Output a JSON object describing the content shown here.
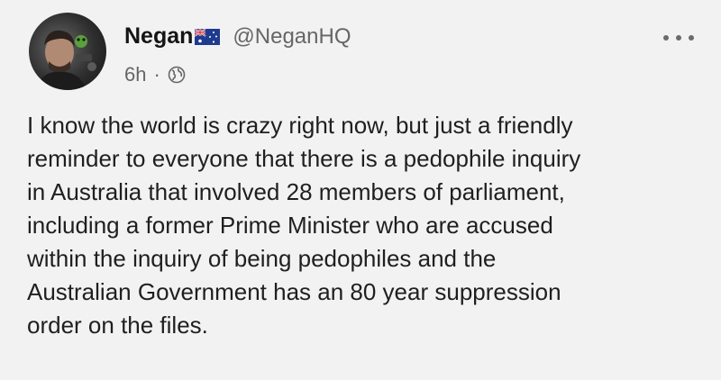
{
  "post": {
    "display_name": "Negan",
    "flag_icon": "australian-flag-icon",
    "handle": "@NeganHQ",
    "time": "6h",
    "separator": "·",
    "visibility_icon": "globe-icon",
    "more_icon": "more-options-icon",
    "body_lines": [
      "I know the world is crazy right now, but just a friendly",
      "reminder to everyone that there is a pedophile inquiry",
      "in Australia that involved 28 members of parliament,",
      "including a former Prime Minister who are accused",
      "within the inquiry of being pedophiles and the",
      "Australian Government has an 80 year suppression",
      "order on the files."
    ]
  },
  "colors": {
    "background": "#f2f2f2",
    "text": "#1f1f1f",
    "secondary_text": "#666666"
  }
}
